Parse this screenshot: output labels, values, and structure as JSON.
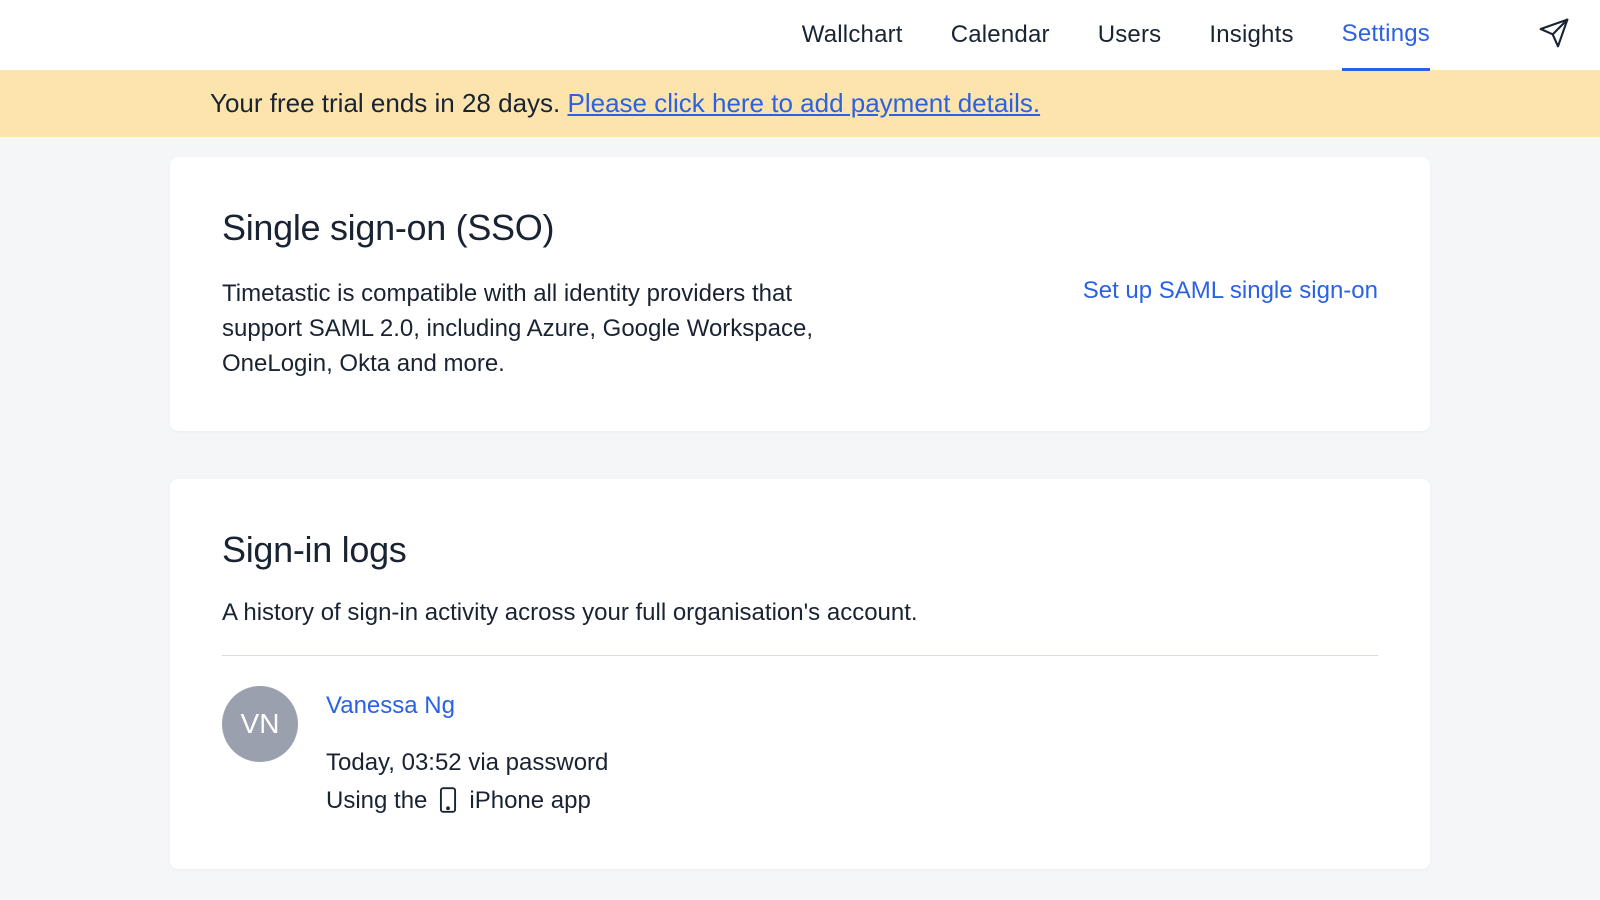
{
  "nav": {
    "items": [
      {
        "label": "Wallchart"
      },
      {
        "label": "Calendar"
      },
      {
        "label": "Users"
      },
      {
        "label": "Insights"
      },
      {
        "label": "Settings"
      }
    ]
  },
  "banner": {
    "text_prefix": "Your free trial ends in 28 days. ",
    "link_text": "Please click here to add payment details."
  },
  "sso_card": {
    "title": "Single sign-on (SSO)",
    "description": "Timetastic is compatible with all identity providers that support SAML 2.0, including Azure, Google Workspace, OneLogin, Okta and more.",
    "link": "Set up SAML single sign-on"
  },
  "signin_card": {
    "title": "Sign-in logs",
    "description": "A history of sign-in activity across your full organisation's account.",
    "log": {
      "initials": "VN",
      "name": "Vanessa Ng",
      "time_line": "Today, 03:52 via password",
      "using_prefix": "Using the",
      "using_suffix": "iPhone app"
    }
  }
}
